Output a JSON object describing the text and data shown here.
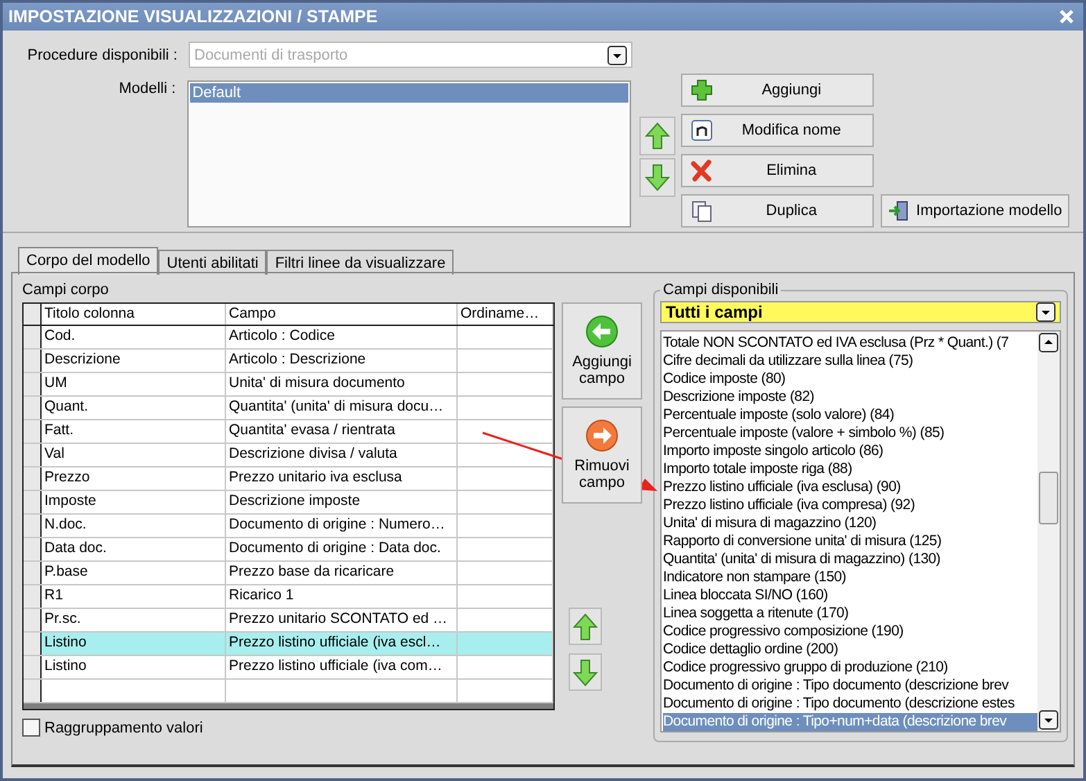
{
  "window": {
    "title": "IMPOSTAZIONE VISUALIZZAZIONI / STAMPE"
  },
  "procedure": {
    "label": "Procedure disponibili :",
    "value": "Documenti di trasporto",
    "disabled": true
  },
  "models": {
    "label": "Modelli :",
    "items": [
      {
        "label": "Default",
        "selected": true
      }
    ]
  },
  "model_buttons": [
    {
      "label": "Aggiungi",
      "kind": "add"
    },
    {
      "label": "Modifica nome",
      "kind": "rename"
    },
    {
      "label": "Elimina",
      "kind": "delete"
    },
    {
      "label": "Duplica",
      "kind": "duplicate"
    },
    {
      "label": "Importazione modello",
      "kind": "import"
    }
  ],
  "tabs": [
    {
      "label": "Corpo del modello",
      "selected": true
    },
    {
      "label": "Utenti abilitati",
      "selected": false
    },
    {
      "label": "Filtri linee da visualizzare",
      "selected": false
    }
  ],
  "body_fields": {
    "title": "Campi corpo",
    "columns": [
      "Titolo colonna",
      "Campo",
      "Ordiname…"
    ],
    "rows": [
      {
        "title": "Cod.",
        "field": "Articolo : Codice",
        "selected": false
      },
      {
        "title": "Descrizione",
        "field": "Articolo : Descrizione",
        "selected": false
      },
      {
        "title": "UM",
        "field": "Unita' di misura documento",
        "selected": false
      },
      {
        "title": "Quant.",
        "field": "Quantita' (unita' di misura docu…",
        "selected": false
      },
      {
        "title": "Fatt.",
        "field": "Quantita' evasa / rientrata",
        "selected": false
      },
      {
        "title": "Val",
        "field": "Descrizione divisa / valuta",
        "selected": false
      },
      {
        "title": "Prezzo",
        "field": "Prezzo unitario iva esclusa",
        "selected": false
      },
      {
        "title": "Imposte",
        "field": "Descrizione imposte",
        "selected": false
      },
      {
        "title": "N.doc.",
        "field": "Documento di origine : Numero…",
        "selected": false
      },
      {
        "title": "Data doc.",
        "field": "Documento di origine : Data doc.",
        "selected": false
      },
      {
        "title": "P.base",
        "field": "Prezzo base da ricaricare",
        "selected": false
      },
      {
        "title": "R1",
        "field": "Ricarico 1",
        "selected": false
      },
      {
        "title": "Pr.sc.",
        "field": "Prezzo unitario SCONTATO ed …",
        "selected": false
      },
      {
        "title": "Listino",
        "field": "Prezzo listino ufficiale (iva escl…",
        "selected": true
      },
      {
        "title": "Listino",
        "field": "Prezzo listino ufficiale (iva com…",
        "selected": false
      }
    ]
  },
  "field_buttons": [
    {
      "label": "Aggiungi campo",
      "kind": "add"
    },
    {
      "label": "Rimuovi campo",
      "kind": "remove"
    }
  ],
  "grouping": {
    "label": "Raggruppamento valori",
    "checked": false
  },
  "available_fields": {
    "title": "Campi disponibili",
    "filter": "Tutti i campi",
    "items": [
      {
        "label": "Totale NON SCONTATO ed IVA esclusa (Prz * Quant.) (7",
        "selected": false
      },
      {
        "label": "Cifre decimali da utilizzare sulla linea (75)",
        "selected": false
      },
      {
        "label": "Codice imposte (80)",
        "selected": false
      },
      {
        "label": "Descrizione imposte (82)",
        "selected": false
      },
      {
        "label": "Percentuale imposte (solo valore) (84)",
        "selected": false
      },
      {
        "label": "Percentuale imposte (valore + simbolo %) (85)",
        "selected": false
      },
      {
        "label": "Importo imposte singolo articolo (86)",
        "selected": false
      },
      {
        "label": "Importo totale imposte riga (88)",
        "selected": false
      },
      {
        "label": "Prezzo listino ufficiale (iva esclusa) (90)",
        "selected": false
      },
      {
        "label": "Prezzo listino ufficiale (iva compresa) (92)",
        "selected": false
      },
      {
        "label": "Unita' di misura di magazzino (120)",
        "selected": false
      },
      {
        "label": "Rapporto di conversione unita' di misura (125)",
        "selected": false
      },
      {
        "label": "Quantita' (unita' di misura di magazzino) (130)",
        "selected": false
      },
      {
        "label": "Indicatore non stampare (150)",
        "selected": false
      },
      {
        "label": "Linea bloccata SI/NO (160)",
        "selected": false
      },
      {
        "label": "Linea soggetta a ritenute (170)",
        "selected": false
      },
      {
        "label": "Codice progressivo composizione (190)",
        "selected": false
      },
      {
        "label": "Codice dettaglio ordine (200)",
        "selected": false
      },
      {
        "label": "Codice progressivo gruppo di produzione (210)",
        "selected": false
      },
      {
        "label": "Documento di origine : Tipo documento (descrizione brev",
        "selected": false
      },
      {
        "label": "Documento di origine : Tipo documento (descrizione estes",
        "selected": false
      },
      {
        "label": "Documento di origine : Tipo+num+data (descrizione brev",
        "selected": true
      }
    ]
  }
}
